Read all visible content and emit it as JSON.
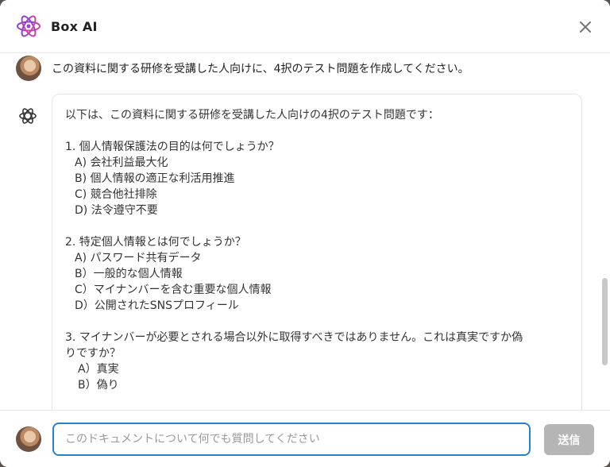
{
  "header": {
    "title": "Box AI",
    "logo_icon": "box-ai-atom-icon",
    "close_icon": "close-icon"
  },
  "conversation": {
    "user_message": "この資料に関する研修を受講した人向けに、4択のテスト問題を作成してください。",
    "ai_response": {
      "intro": "以下は、この資料に関する研修を受講した人向けの4択のテスト問題です：",
      "questions": [
        {
          "question": "1. 個人情報保護法の目的は何でしょうか？",
          "options": [
            "A) 会社利益最大化",
            "B) 個人情報の適正な利活用推進",
            "C) 競合他社排除",
            "D) 法令遵守不要"
          ]
        },
        {
          "question": "2. 特定個人情報とは何でしょうか？",
          "options": [
            "A) パスワード共有データ",
            "B）一般的な個人情報",
            "C）マイナンバーを含む重要な個人情報",
            "D）公開されたSNSプロフィール"
          ]
        },
        {
          "question_line1": "3. マイナンバーが必要とされる場合以外に取得すべきではありません。これは真実ですか偽",
          "question_line2": "りですか？",
          "options": [
            "A）真実",
            "B）偽り"
          ]
        }
      ]
    }
  },
  "composer": {
    "placeholder": "このドキュメントについて何でも質問してください",
    "value": "",
    "send_label": "送信"
  },
  "colors": {
    "accent_blue": "#2b7fd3",
    "send_disabled": "#b5b5b5",
    "logo_purple": "#7b3fe4",
    "logo_pink": "#e0468f"
  }
}
